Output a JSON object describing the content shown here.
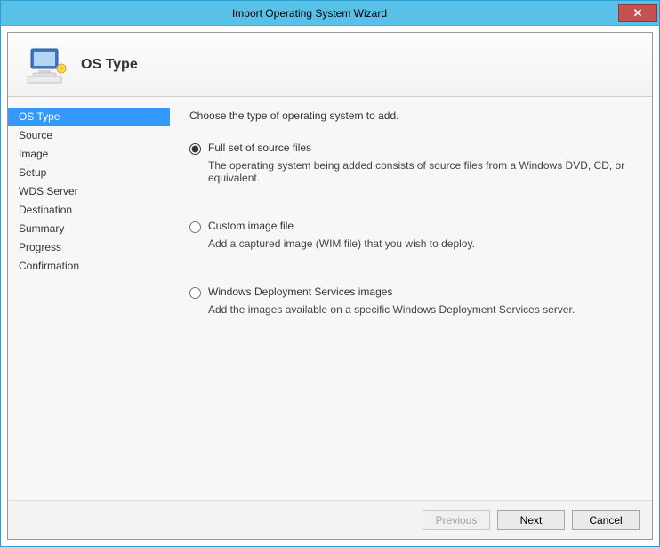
{
  "window": {
    "title": "Import Operating System Wizard"
  },
  "header": {
    "title": "OS Type"
  },
  "sidebar": {
    "items": [
      {
        "label": "OS Type",
        "selected": true
      },
      {
        "label": "Source",
        "selected": false
      },
      {
        "label": "Image",
        "selected": false
      },
      {
        "label": "Setup",
        "selected": false
      },
      {
        "label": "WDS Server",
        "selected": false
      },
      {
        "label": "Destination",
        "selected": false
      },
      {
        "label": "Summary",
        "selected": false
      },
      {
        "label": "Progress",
        "selected": false
      },
      {
        "label": "Confirmation",
        "selected": false
      }
    ]
  },
  "content": {
    "instruction": "Choose the type of operating system to add.",
    "options": [
      {
        "label": "Full set of source files",
        "description": "The operating system being added consists of source files from a Windows DVD, CD, or equivalent.",
        "selected": true
      },
      {
        "label": "Custom image file",
        "description": "Add a captured image (WIM file) that you wish to deploy.",
        "selected": false
      },
      {
        "label": "Windows Deployment Services images",
        "description": "Add the images available on a specific Windows Deployment Services server.",
        "selected": false
      }
    ]
  },
  "footer": {
    "previous": "Previous",
    "next": "Next",
    "cancel": "Cancel"
  }
}
